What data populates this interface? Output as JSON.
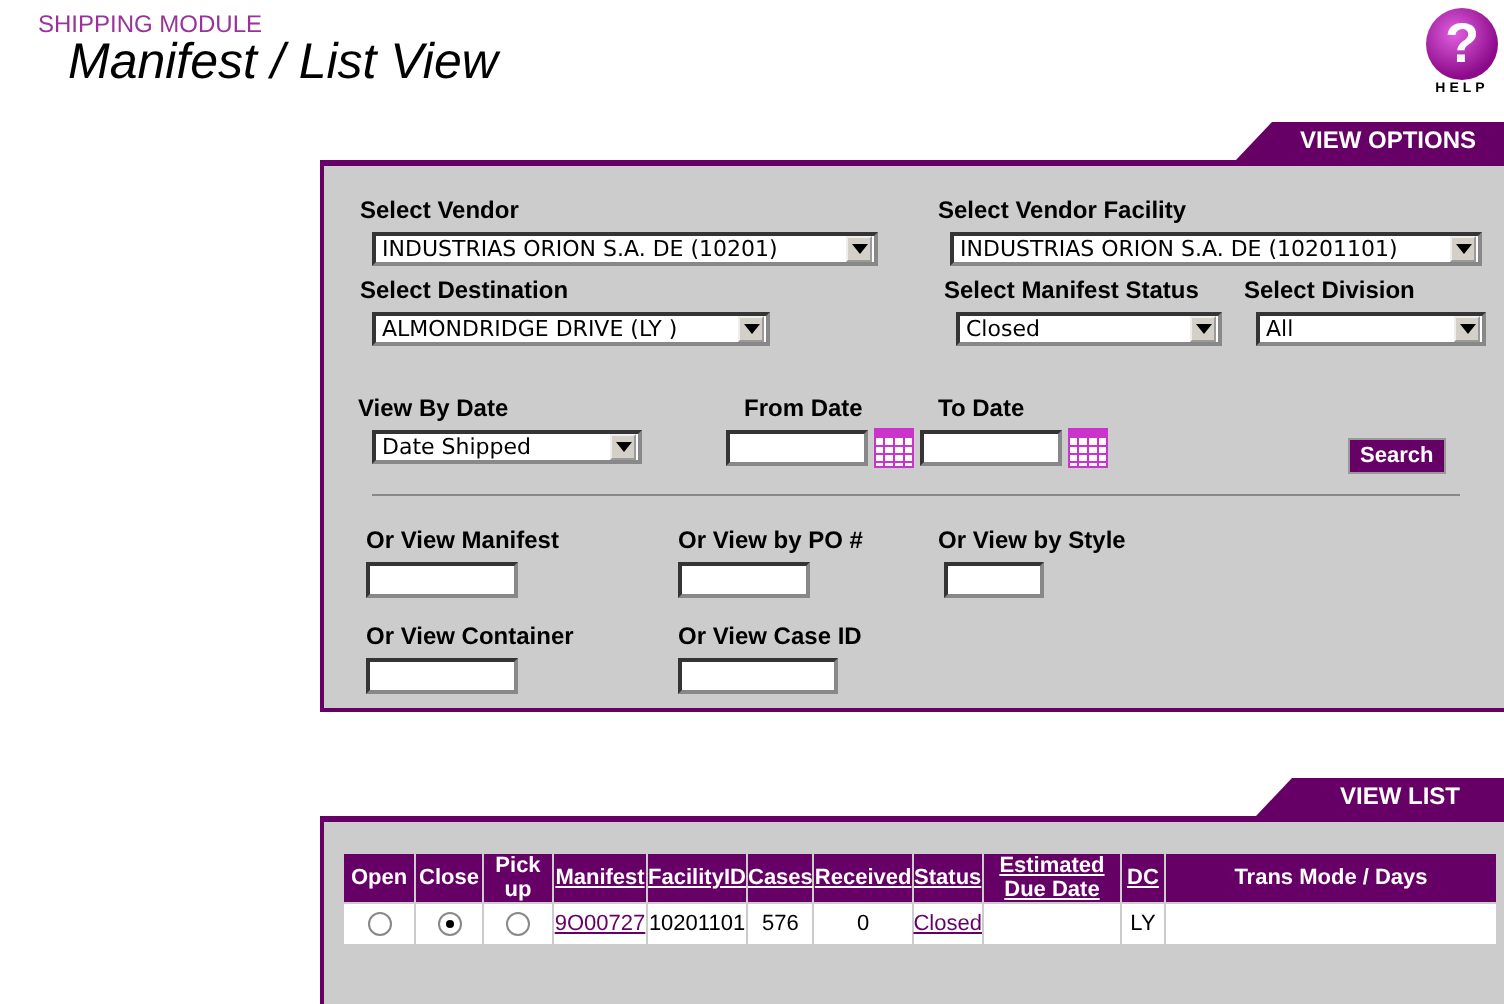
{
  "header": {
    "module": "SHIPPING MODULE",
    "title": "Manifest / List View"
  },
  "help": {
    "glyph": "?",
    "label": "HELP"
  },
  "view_options": {
    "tab": "VIEW OPTIONS",
    "fields": [
      {
        "kind": "select",
        "label": "Select Vendor",
        "value": "INDUSTRIAS ORION S.A. DE (10201)"
      },
      {
        "kind": "select",
        "label": "Select Vendor Facility",
        "value": "INDUSTRIAS ORION S.A. DE (10201101)"
      },
      {
        "kind": "select",
        "label": "Select Destination",
        "value": "ALMONDRIDGE DRIVE (LY )"
      },
      {
        "kind": "select",
        "label": "Select Manifest Status",
        "value": "Closed"
      },
      {
        "kind": "select",
        "label": "Select Division",
        "value": "All"
      },
      {
        "kind": "select",
        "label": "View By Date",
        "value": "Date Shipped"
      },
      {
        "kind": "date",
        "label": "From Date"
      },
      {
        "kind": "date",
        "label": "To Date"
      },
      {
        "kind": "button",
        "label": "Search"
      },
      {
        "kind": "rule"
      },
      {
        "kind": "text",
        "label": "Or View Manifest"
      },
      {
        "kind": "text",
        "label": "Or View by PO #"
      },
      {
        "kind": "text",
        "label": "Or View by Style"
      },
      {
        "kind": "text",
        "label": "Or View Container"
      },
      {
        "kind": "text",
        "label": "Or View Case ID"
      }
    ]
  },
  "view_list": {
    "tab": "VIEW LIST",
    "columns": [
      {
        "label": "Open",
        "sortable": false
      },
      {
        "label": "Close",
        "sortable": false
      },
      {
        "label": "Pick up",
        "sortable": false
      },
      {
        "label": "Manifest",
        "sortable": true
      },
      {
        "label": "FacilityID",
        "sortable": true
      },
      {
        "label": "Cases",
        "sortable": true
      },
      {
        "label": "Received",
        "sortable": true
      },
      {
        "label": "Status",
        "sortable": true
      },
      {
        "label": "Estimated Due Date",
        "sortable": true
      },
      {
        "label": "DC",
        "sortable": true
      },
      {
        "label": "Trans Mode / Days",
        "sortable": false
      }
    ],
    "rows": [
      {
        "cells": [
          {
            "kind": "radio",
            "selected": false
          },
          {
            "kind": "radio",
            "selected": true
          },
          {
            "kind": "radio",
            "selected": false
          },
          {
            "kind": "link",
            "text": "9O00727"
          },
          {
            "kind": "plain",
            "text": "10201101"
          },
          {
            "kind": "plain",
            "text": "576"
          },
          {
            "kind": "plain",
            "text": "0"
          },
          {
            "kind": "link",
            "text": "Closed"
          },
          {
            "kind": "empty"
          },
          {
            "kind": "plain",
            "text": "LY"
          },
          {
            "kind": "empty"
          }
        ]
      }
    ]
  }
}
